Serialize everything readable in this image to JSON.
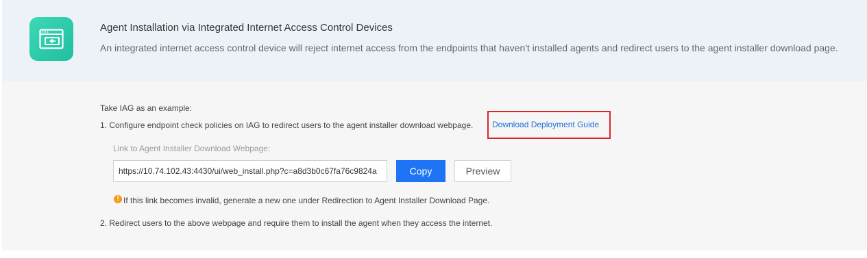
{
  "header": {
    "icon": "browser-redirect-icon",
    "title": "Agent Installation via Integrated Internet Access Control Devices",
    "description": "An integrated internet access control device will reject internet access from the endpoints that haven't installed agents and redirect users to the agent installer download page."
  },
  "content": {
    "intro": "Take IAG as an example:",
    "step1": "1. Configure endpoint check policies on IAG to redirect users to the agent installer download webpage.",
    "guide_link": "Download Deployment Guide",
    "link_label": "Link to Agent Installer Download Webpage:",
    "link_value": "https://10.74.102.43:4430/ui/web_install.php?c=a8d3b0c67fa76c9824a",
    "copy_label": "Copy",
    "preview_label": "Preview",
    "warning_icon": "warning-icon",
    "warning_text": "If this link becomes invalid, generate a new one under Redirection to Agent Installer Download Page.",
    "step2": "2. Redirect users to the above webpage and require them to install the agent when they access the internet."
  },
  "colors": {
    "accent": "#1e74f5",
    "icon_bg": "#2ccfae",
    "highlight_border": "#d9262c",
    "warning": "#f39c12",
    "header_bg": "#edf2f9",
    "content_bg": "#f6f6f6"
  }
}
